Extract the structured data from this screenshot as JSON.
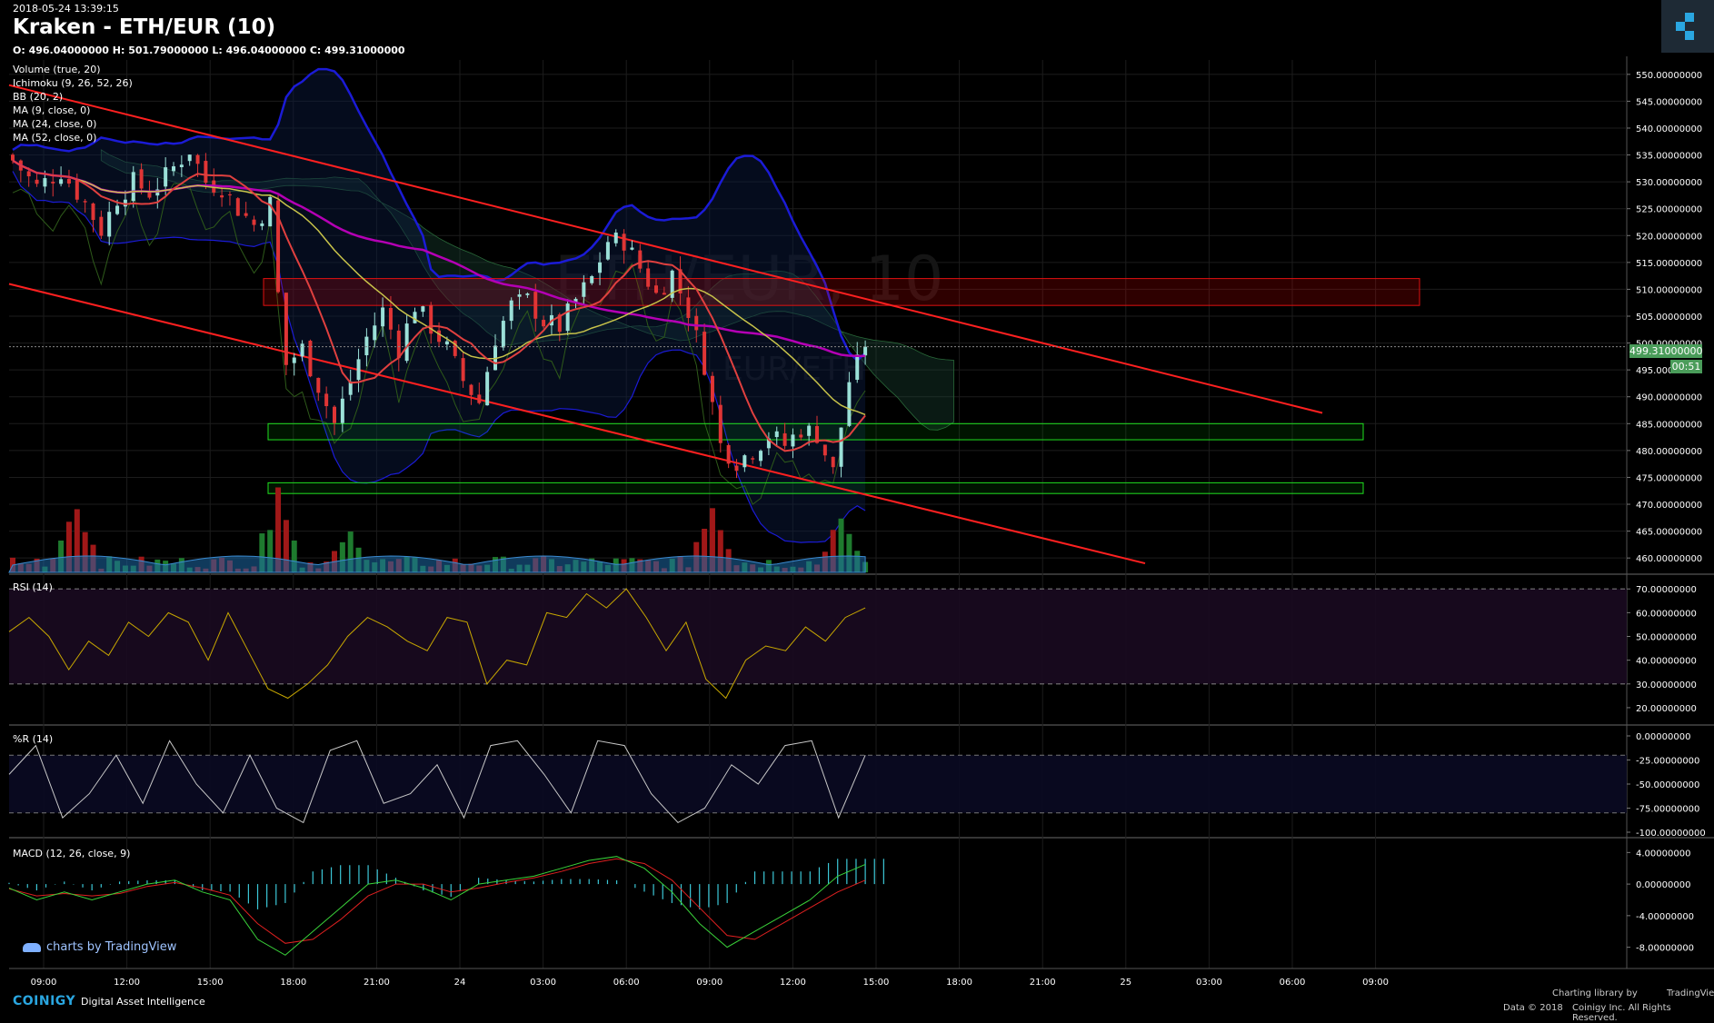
{
  "header": {
    "timestamp": "2018-05-24 13:39:15",
    "title": "Kraken - ETH/EUR (10)",
    "ohlc": "O: 496.04000000 H: 501.79000000 L: 496.04000000 C: 499.31000000"
  },
  "watermark": {
    "symbol": "ETH/EUR, 10",
    "sub": "EUR/ETH"
  },
  "indicators": [
    "Volume (true, 20)",
    "Ichimoku (9, 26, 52, 26)",
    "BB (20, 2)",
    "MA (9, close, 0)",
    "MA (24, close, 0)",
    "MA (52, close, 0)"
  ],
  "price_badge": {
    "price": "499.31000000",
    "countdown": "00:51"
  },
  "panes": {
    "rsi": "RSI (14)",
    "wr": "%R (14)",
    "macd": "MACD (12, 26, close, 9)"
  },
  "branding": {
    "tv": "charts by TradingView",
    "coinigy": "COINIGY",
    "tagline": "Digital Asset Intelligence",
    "lib": "Charting library by",
    "tv_small": "TradingView",
    "copyright": "Data © 2018",
    "copyright2": "Coinigy Inc. All Rights Reserved."
  },
  "colors": {
    "up": "#22c55e",
    "down": "#ef2b2b",
    "bb": "#1b1bd6",
    "ma9": "#e0403f",
    "ma24": "#c8c34a",
    "ma52": "#b400b4",
    "trend": "#ff2020",
    "rsi": "#c8a800",
    "wr": "#c8c8c8",
    "macd": "#3ad23a",
    "signal": "#e02020",
    "hist": "#3cc8d8"
  },
  "chart_data": [
    {
      "type": "candlestick",
      "title": "Kraken - ETH/EUR (10)",
      "x_ticks": [
        "09:00",
        "12:00",
        "15:00",
        "18:00",
        "21:00",
        "24",
        "03:00",
        "06:00",
        "09:00",
        "12:00",
        "15:00",
        "18:00",
        "21:00",
        "25",
        "03:00",
        "06:00",
        "09:00"
      ],
      "y_ticks": [
        "550.00000000",
        "545.00000000",
        "540.00000000",
        "535.00000000",
        "530.00000000",
        "525.00000000",
        "520.00000000",
        "515.00000000",
        "510.00000000",
        "505.00000000",
        "500.00000000",
        "495.00000000",
        "490.00000000",
        "485.00000000",
        "480.00000000",
        "475.00000000",
        "470.00000000",
        "465.00000000",
        "460.00000000"
      ],
      "ylim": [
        458,
        552
      ],
      "last_price": 499.31,
      "close_path": [
        [
          0,
          534
        ],
        [
          3,
          529
        ],
        [
          6,
          532
        ],
        [
          9,
          526
        ],
        [
          11,
          521
        ],
        [
          13,
          527
        ],
        [
          15,
          530
        ],
        [
          17,
          528
        ],
        [
          19,
          531
        ],
        [
          22,
          536
        ],
        [
          24,
          530
        ],
        [
          26,
          529
        ],
        [
          28,
          525
        ],
        [
          30,
          522
        ],
        [
          32,
          526
        ],
        [
          33,
          509
        ],
        [
          34,
          496
        ],
        [
          36,
          499
        ],
        [
          38,
          492
        ],
        [
          40,
          485
        ],
        [
          42,
          493
        ],
        [
          44,
          501
        ],
        [
          46,
          506
        ],
        [
          48,
          499
        ],
        [
          50,
          507
        ],
        [
          52,
          503
        ],
        [
          54,
          499
        ],
        [
          56,
          493
        ],
        [
          58,
          489
        ],
        [
          60,
          501
        ],
        [
          62,
          507
        ],
        [
          64,
          508
        ],
        [
          66,
          504
        ],
        [
          68,
          503
        ],
        [
          70,
          508
        ],
        [
          72,
          512
        ],
        [
          74,
          519
        ],
        [
          76,
          519
        ],
        [
          78,
          514
        ],
        [
          80,
          509
        ],
        [
          82,
          513
        ],
        [
          84,
          506
        ],
        [
          86,
          496
        ],
        [
          88,
          481
        ],
        [
          90,
          478
        ],
        [
          92,
          480
        ],
        [
          94,
          483
        ],
        [
          96,
          481
        ],
        [
          98,
          484
        ],
        [
          100,
          483
        ],
        [
          102,
          476
        ],
        [
          104,
          493
        ],
        [
          106,
          499
        ]
      ],
      "volume_spikes": [
        [
          8,
          0.75
        ],
        [
          33,
          0.95
        ],
        [
          42,
          0.3
        ],
        [
          87,
          0.8
        ],
        [
          103,
          0.5
        ]
      ],
      "zones": [
        {
          "type": "resistance",
          "from": 512,
          "to": 507
        },
        {
          "type": "support",
          "from": 485,
          "to": 482
        },
        {
          "type": "support",
          "from": 474,
          "to": 472
        }
      ]
    },
    {
      "type": "line",
      "name": "RSI (14)",
      "y_ticks": [
        "70.00000000",
        "60.00000000",
        "50.00000000",
        "40.00000000",
        "30.00000000",
        "20.00000000"
      ],
      "ylim": [
        15,
        72
      ],
      "values": [
        52,
        58,
        50,
        36,
        48,
        42,
        56,
        50,
        60,
        56,
        40,
        60,
        44,
        28,
        24,
        30,
        38,
        50,
        58,
        54,
        48,
        44,
        58,
        56,
        30,
        40,
        38,
        60,
        58,
        68,
        62,
        70,
        58,
        44,
        56,
        32,
        24,
        40,
        46,
        44,
        54,
        48,
        58,
        62
      ]
    },
    {
      "type": "line",
      "name": "%R (14)",
      "y_ticks": [
        "0.00000000",
        "-25.00000000",
        "-50.00000000",
        "-75.00000000",
        "-100.00000000"
      ],
      "ylim": [
        -100,
        0
      ],
      "values": [
        -40,
        -10,
        -85,
        -60,
        -20,
        -70,
        -5,
        -50,
        -80,
        -20,
        -75,
        -90,
        -15,
        -5,
        -70,
        -60,
        -30,
        -85,
        -10,
        -5,
        -40,
        -80,
        -5,
        -10,
        -60,
        -90,
        -75,
        -30,
        -50,
        -10,
        -5,
        -85,
        -20
      ]
    },
    {
      "type": "line",
      "name": "MACD (12, 26, close, 9)",
      "y_ticks": [
        "4.00000000",
        "0.00000000",
        "-4.00000000",
        "-8.00000000"
      ],
      "ylim": [
        -10,
        4.5
      ],
      "macd": [
        -0.5,
        -2,
        -1,
        -2,
        -1,
        0,
        0.5,
        -1,
        -2,
        -7,
        -9,
        -6,
        -3,
        0,
        0.5,
        -0.5,
        -2,
        0,
        0.5,
        1,
        2,
        3,
        3.5,
        2,
        -1,
        -5,
        -8,
        -6,
        -4,
        -2,
        1,
        2.5
      ],
      "signal": [
        -0.6,
        -1.5,
        -1.2,
        -1.5,
        -1.2,
        -0.3,
        0.2,
        -0.5,
        -1.4,
        -5,
        -7.5,
        -7,
        -4.5,
        -1.5,
        0,
        0,
        -1,
        -0.5,
        0.2,
        0.8,
        1.6,
        2.6,
        3.2,
        2.6,
        0.5,
        -3,
        -6.5,
        -7,
        -5,
        -3,
        -1,
        0.5
      ]
    }
  ]
}
